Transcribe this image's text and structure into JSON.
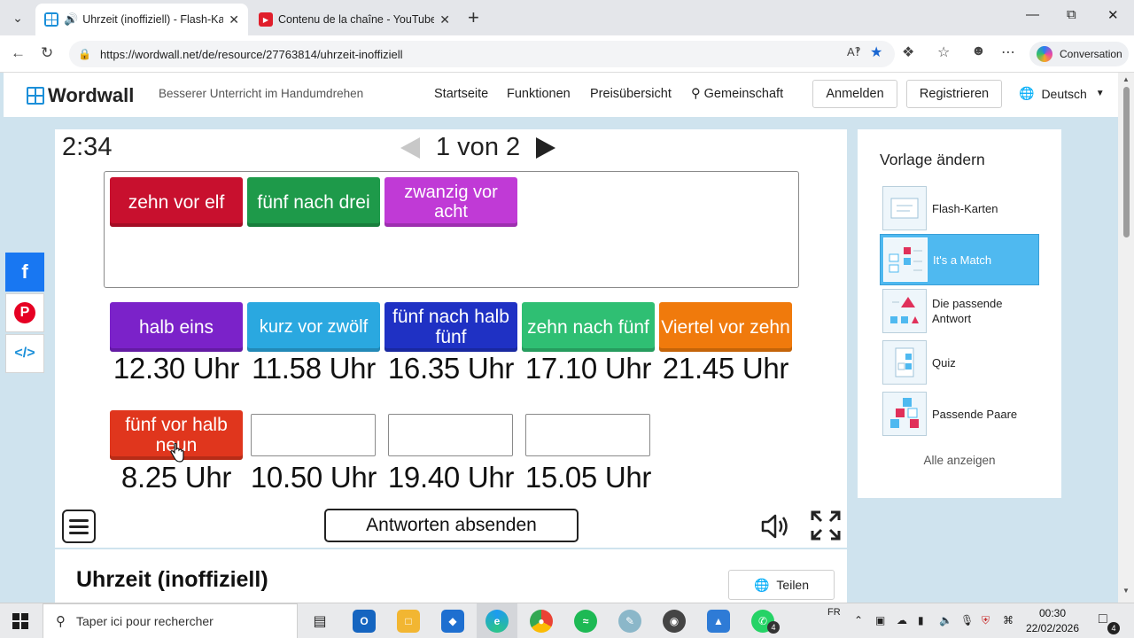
{
  "browser": {
    "tabs": [
      {
        "title": "Uhrzeit (inoffiziell) - Flash-Karte",
        "active": true
      },
      {
        "title": "Contenu de la chaîne - YouTube St",
        "active": false
      }
    ],
    "url": "https://wordwall.net/de/resource/27763814/uhrzeit-inoffiziell",
    "copilot_label": "Conversation"
  },
  "site": {
    "logo": "Wordwall",
    "tagline": "Besserer Unterricht im Handumdrehen",
    "nav": [
      "Startseite",
      "Funktionen",
      "Preisübersicht",
      "Gemeinschaft"
    ],
    "login": "Anmelden",
    "register": "Registrieren",
    "language": "Deutsch"
  },
  "activity": {
    "timer": "2:34",
    "page": "1 von 2",
    "pool_cards": [
      {
        "text": "zehn vor elf",
        "color": "#c8102e"
      },
      {
        "text": "fünf nach drei",
        "color": "#1e9a4a"
      },
      {
        "text": "zwanzig vor acht",
        "color": "#c03ad6"
      }
    ],
    "placed_cards": [
      {
        "text": "halb eins",
        "color": "#7b22c9"
      },
      {
        "text": "kurz vor zwölf",
        "color": "#2aa8e0"
      },
      {
        "text": "fünf nach halb fünf",
        "color": "#1f31c4"
      },
      {
        "text": "zehn nach fünf",
        "color": "#2fbf73"
      },
      {
        "text": "Viertel vor zehn",
        "color": "#f07a0c"
      },
      {
        "text": "fünf vor halb neun",
        "color": "#e0361d"
      }
    ],
    "times_row1": [
      "12.30 Uhr",
      "11.58 Uhr",
      "16.35 Uhr",
      "17.10 Uhr",
      "21.45 Uhr"
    ],
    "times_row2": [
      "8.25 Uhr",
      "10.50 Uhr",
      "19.40 Uhr",
      "15.05 Uhr"
    ],
    "submit_label": "Antworten absenden"
  },
  "templates": {
    "title": "Vorlage ändern",
    "items": [
      "Flash-Karten",
      "It's a Match",
      "Die passende Antwort",
      "Quiz",
      "Passende Paare"
    ],
    "active_index": 1,
    "see_all": "Alle anzeigen"
  },
  "resource": {
    "title": "Uhrzeit (inoffiziell)",
    "share_label": "Teilen"
  },
  "taskbar": {
    "search_placeholder": "Taper ici pour rechercher",
    "lang": "FR",
    "time": "00:30",
    "date": "22/02/2026",
    "notifications": "4",
    "whatsapp_badge": "4"
  }
}
